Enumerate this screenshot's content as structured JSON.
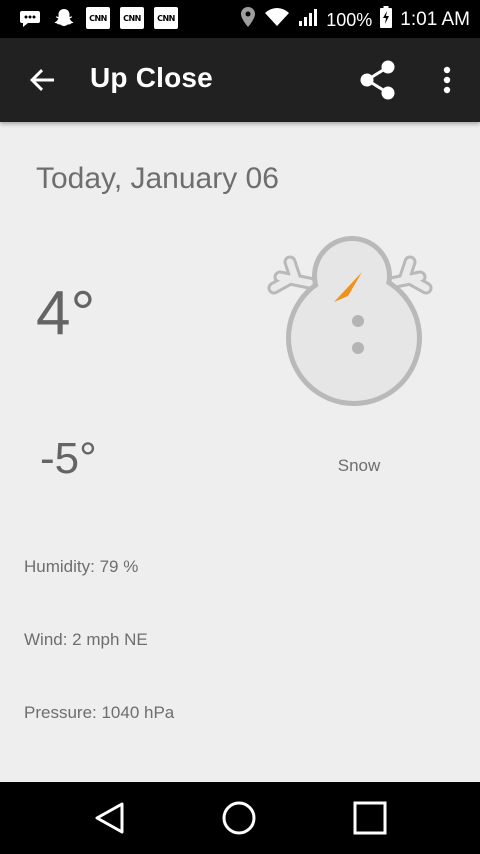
{
  "status_bar": {
    "notifications": [
      "messages-icon",
      "snapchat-icon",
      "cnn-icon",
      "cnn-icon",
      "cnn-icon"
    ],
    "cnn_label": "CNN",
    "battery": "100%",
    "time": "1:01 AM"
  },
  "app_bar": {
    "title": "Up Close"
  },
  "forecast": {
    "date": "Today, January 06",
    "high": "4°",
    "low": "-5°",
    "condition": "Snow",
    "humidity": "Humidity: 79 %",
    "wind": "Wind: 2 mph NE",
    "pressure": "Pressure: 1040 hPa"
  },
  "colors": {
    "app_bar": "#212121",
    "background": "#eeeeee",
    "text": "#6e6e6e",
    "carrot": "#f0921a"
  }
}
